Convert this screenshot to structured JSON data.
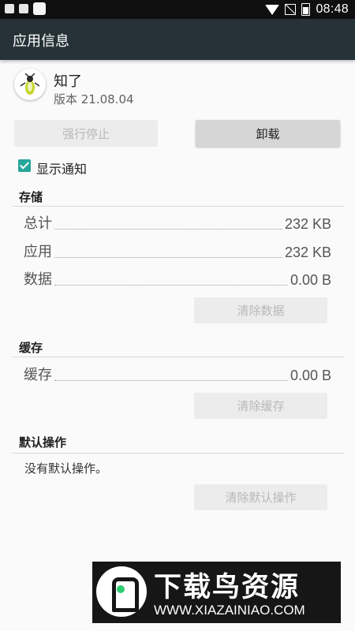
{
  "status_bar": {
    "time": "08:48",
    "icons": [
      "notification-icon",
      "android-icon",
      "square-icon",
      "wifi-icon",
      "no-signal-icon",
      "battery-icon"
    ]
  },
  "toolbar": {
    "title": "应用信息"
  },
  "app": {
    "name": "知了",
    "version": "版本 21.08.04",
    "icon": "firefly-icon"
  },
  "buttons": {
    "force_stop": "强行停止",
    "uninstall": "卸载"
  },
  "notifications": {
    "label": "显示通知",
    "checked": true
  },
  "storage": {
    "header": "存储",
    "rows": [
      {
        "label": "总计",
        "value": "232 KB"
      },
      {
        "label": "应用",
        "value": "232 KB"
      },
      {
        "label": "数据",
        "value": "0.00 B"
      }
    ],
    "clear_button": "清除数据"
  },
  "cache": {
    "header": "缓存",
    "rows": [
      {
        "label": "缓存",
        "value": "0.00 B"
      }
    ],
    "clear_button": "清除缓存"
  },
  "defaults": {
    "header": "默认操作",
    "text": "没有默认操作。",
    "clear_button": "清除默认操作"
  },
  "watermark": {
    "text": "下载鸟资源",
    "url": "WWW.XIAZAINIAO.COM"
  },
  "colors": {
    "toolbar": "#263238",
    "accent": "#26a69a",
    "status_bar": "#0f0f0f"
  }
}
